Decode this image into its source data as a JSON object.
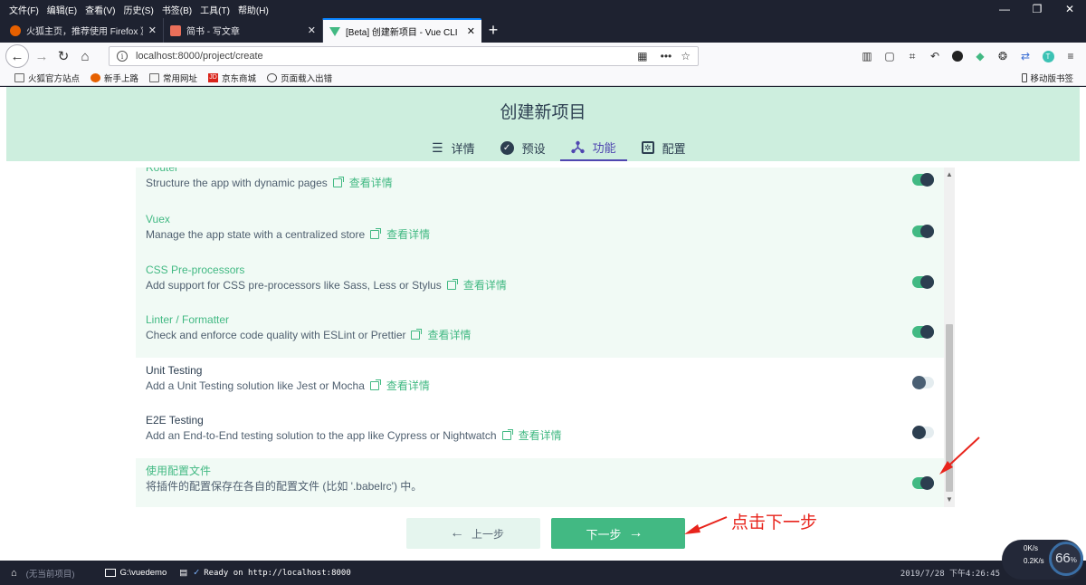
{
  "menubar": {
    "items": [
      "文件(F)",
      "编辑(E)",
      "查看(V)",
      "历史(S)",
      "书签(B)",
      "工具(T)",
      "帮助(H)"
    ],
    "window_controls": [
      "—",
      "❐",
      "✕"
    ]
  },
  "tabs": [
    {
      "title": "火狐主页，推荐使用 Firefox 》",
      "favicon_color": "#e66000"
    },
    {
      "title": "简书 - 写文章",
      "favicon_color": "#ea6f5a"
    },
    {
      "title": "[Beta] 创建新项目 - Vue CLI",
      "favicon_color": "#42b983"
    }
  ],
  "navbar": {
    "url": "localhost:8000/project/create"
  },
  "bookmarks": {
    "items": [
      "火狐官方站点",
      "新手上路",
      "常用网址",
      "京东商城",
      "页面载入出错"
    ],
    "mobile": "移动版书签"
  },
  "page": {
    "title": "创建新项目",
    "steps": [
      {
        "label": "详情",
        "icon": "list-icon"
      },
      {
        "label": "预设",
        "icon": "check-circle-icon"
      },
      {
        "label": "功能",
        "icon": "fork-icon"
      },
      {
        "label": "配置",
        "icon": "settings-box-icon"
      }
    ],
    "more_link": "查看详情",
    "features": [
      {
        "name": "Router",
        "desc": "Structure the app with dynamic pages",
        "enabled": true,
        "link": true
      },
      {
        "name": "Vuex",
        "desc": "Manage the app state with a centralized store",
        "enabled": true,
        "link": true
      },
      {
        "name": "CSS Pre-processors",
        "desc": "Add support for CSS pre-processors like Sass, Less or Stylus",
        "enabled": true,
        "link": true
      },
      {
        "name": "Linter / Formatter",
        "desc": "Check and enforce code quality with ESLint or Prettier",
        "enabled": true,
        "link": true
      },
      {
        "name": "Unit Testing",
        "desc": "Add a Unit Testing solution like Jest or Mocha",
        "enabled": false,
        "link": true
      },
      {
        "name": "E2E Testing",
        "desc": "Add an End-to-End testing solution to the app like Cypress or Nightwatch",
        "enabled": false,
        "link": true
      },
      {
        "name": "使用配置文件",
        "desc": "将插件的配置保存在各自的配置文件 (比如 '.babelrc') 中。",
        "enabled": true,
        "link": false
      }
    ],
    "prev_label": "上一步",
    "next_label": "下一步"
  },
  "annotation": {
    "text": "点击下一步",
    "color": "#e8241c"
  },
  "statusbar": {
    "project": "(无当前项目)",
    "path": "G:\\vuedemo",
    "status": "Ready on http://localhost:8000",
    "datetime": "2019/7/28 下午4:26:45"
  },
  "netwidget": {
    "up": "0K/s",
    "down": "0.2K/s",
    "percent": "66"
  },
  "colors": {
    "accent": "#42b983",
    "header_bg": "#cdeede",
    "step_active": "#4f46b0"
  }
}
